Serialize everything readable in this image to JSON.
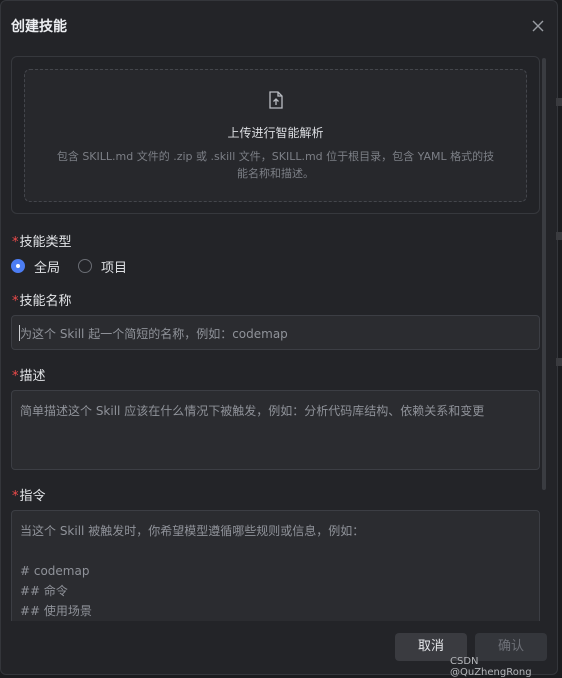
{
  "dialog": {
    "title": "创建技能",
    "close_icon": "close-icon"
  },
  "upload": {
    "icon": "file-upload-icon",
    "title": "上传进行智能解析",
    "description_line1": "包含 SKILL.md 文件的 .zip 或 .skill 文件，SKILL.md 位于根目录，包含 YAML 格式的技",
    "description_line2": "能名称和描述。"
  },
  "skill_type": {
    "required_mark": "*",
    "label": "技能类型",
    "options": [
      {
        "label": "全局",
        "selected": true
      },
      {
        "label": "项目",
        "selected": false
      }
    ]
  },
  "skill_name": {
    "required_mark": "*",
    "label": "技能名称",
    "value": "",
    "placeholder": "为这个 Skill 起一个简短的名称，例如：codemap"
  },
  "description": {
    "required_mark": "*",
    "label": "描述",
    "value": "",
    "placeholder": "简单描述这个 Skill 应该在什么情况下被触发，例如：分析代码库结构、依赖关系和变更"
  },
  "instructions": {
    "required_mark": "*",
    "label": "指令",
    "value": "",
    "placeholder": "当这个 Skill 被触发时，你希望模型遵循哪些规则或信息，例如：\n\n# codemap\n## 命令\n## 使用场景"
  },
  "footer": {
    "cancel_label": "取消",
    "confirm_label": "确认"
  },
  "watermark": "CSDN @QuZhengRong",
  "colors": {
    "accent": "#4c7df3",
    "required": "#f04b4b",
    "background": "#232428"
  }
}
